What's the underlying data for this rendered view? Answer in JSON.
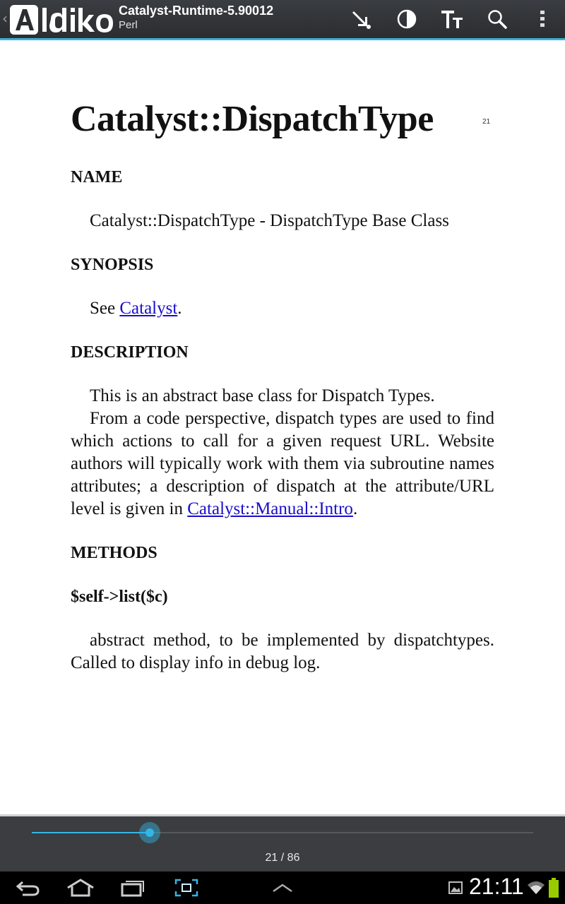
{
  "app": {
    "logo_text": "Aldiko",
    "book_title": "Catalyst-Runtime-5.90012",
    "book_subtitle": "Perl"
  },
  "actionbar": {
    "icons": [
      "goto-icon",
      "brightness-icon",
      "font-size-icon",
      "search-icon",
      "overflow-menu-icon"
    ]
  },
  "page": {
    "page_number": "21",
    "heading": "Catalyst::DispatchType",
    "sections": {
      "name_heading": "NAME",
      "name_text": "Catalyst::DispatchType - DispatchType Base Class",
      "synopsis_heading": "SYNOPSIS",
      "synopsis_prefix": "See ",
      "synopsis_link": "Catalyst",
      "synopsis_suffix": ".",
      "description_heading": "DESCRIPTION",
      "description_p1": "This is an abstract base class for Dispatch Types.",
      "description_p2": "From a code perspective, dispatch types are used to find which actions to call for a given request URL. Website authors will typically work with them via subroutine names attributes; a description of dispatch at the attribute/URL level is given in ",
      "description_link": "Catalyst::Manual::Intro",
      "description_suffix": ".",
      "methods_heading": "METHODS",
      "method_signature": "$self->list($c)",
      "method_text": "abstract method, to be implemented by dispatchtypes. Called to display info in debug log."
    }
  },
  "reader": {
    "progress_fraction": 0.235,
    "page_count": "21 / 86"
  },
  "system": {
    "clock": "21:11",
    "nav_icons": [
      "back-icon",
      "home-icon",
      "recent-apps-icon",
      "screenshot-icon",
      "menu-up-icon"
    ],
    "status_icons": [
      "gallery-notification-icon",
      "wifi-icon",
      "battery-icon"
    ],
    "accent_color": "#33b5e5"
  }
}
